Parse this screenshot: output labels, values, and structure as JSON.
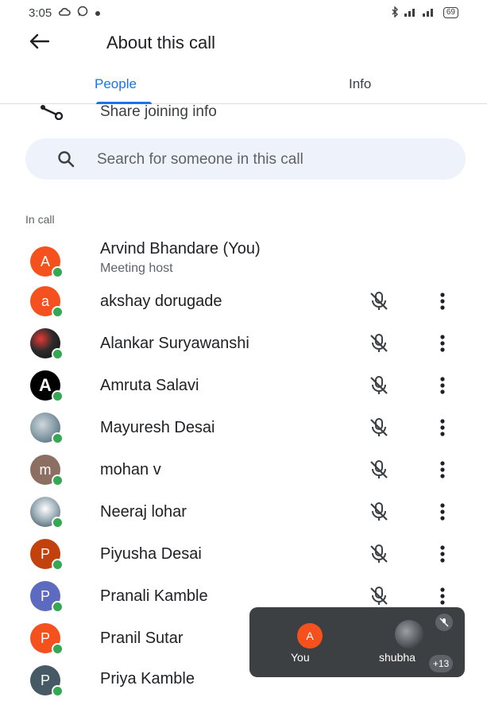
{
  "status_bar": {
    "time": "3:05",
    "battery": "69"
  },
  "header": {
    "title": "About this call",
    "back_icon": "arrow-back-icon"
  },
  "tabs": [
    {
      "label": "People",
      "active": true
    },
    {
      "label": "Info",
      "active": false
    }
  ],
  "share": {
    "label": "Share joining info",
    "icon": "share-icon"
  },
  "search": {
    "placeholder": "Search for someone in this call",
    "value": ""
  },
  "section": {
    "in_call_label": "In call"
  },
  "colors": {
    "accent": "#1a73e8",
    "online": "#34a853"
  },
  "participants": [
    {
      "name": "Arvind Bhandare (You)",
      "subtitle": "Meeting host",
      "initial": "A",
      "avatar_color": "#f4511e",
      "is_photo": false,
      "muted_icon": false
    },
    {
      "name": "akshay dorugade",
      "subtitle": "",
      "initial": "a",
      "avatar_color": "#f4511e",
      "is_photo": false,
      "muted_icon": true
    },
    {
      "name": "Alankar Suryawanshi",
      "subtitle": "",
      "initial": "",
      "avatar_color": "#3c3c3c",
      "is_photo": true,
      "muted_icon": true
    },
    {
      "name": "Amruta Salavi",
      "subtitle": "",
      "initial": "A",
      "avatar_color": "#000000",
      "is_photo": false,
      "muted_icon": true
    },
    {
      "name": "Mayuresh Desai",
      "subtitle": "",
      "initial": "",
      "avatar_color": "#8d9aa6",
      "is_photo": true,
      "muted_icon": true
    },
    {
      "name": "mohan v",
      "subtitle": "",
      "initial": "m",
      "avatar_color": "#8d6e63",
      "is_photo": false,
      "muted_icon": true
    },
    {
      "name": "Neeraj lohar",
      "subtitle": "",
      "initial": "",
      "avatar_color": "#b0bec5",
      "is_photo": true,
      "muted_icon": true
    },
    {
      "name": "Piyusha Desai",
      "subtitle": "",
      "initial": "P",
      "avatar_color": "#c2410c",
      "is_photo": false,
      "muted_icon": true
    },
    {
      "name": "Pranali Kamble",
      "subtitle": "",
      "initial": "P",
      "avatar_color": "#5c6bc0",
      "is_photo": false,
      "muted_icon": true
    },
    {
      "name": "Pranil Sutar",
      "subtitle": "",
      "initial": "P",
      "avatar_color": "#f4511e",
      "is_photo": false,
      "muted_icon": false
    },
    {
      "name": "Priya Kamble",
      "subtitle": "",
      "initial": "P",
      "avatar_color": "#455a64",
      "is_photo": false,
      "muted_icon": false
    }
  ],
  "pip": {
    "you_initial": "A",
    "you_label": "You",
    "other_label": "shubha",
    "extra_count": "+13"
  }
}
